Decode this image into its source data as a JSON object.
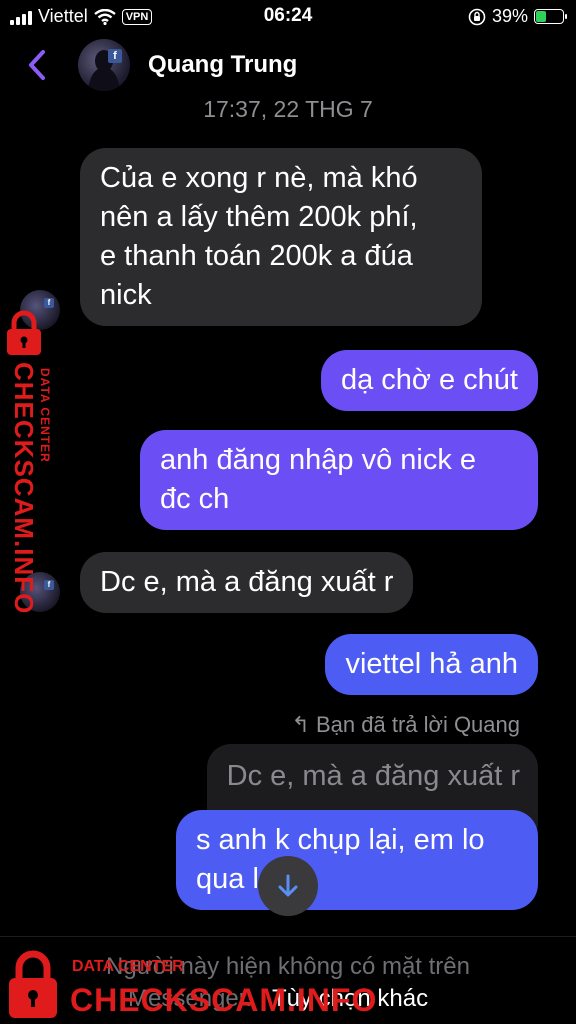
{
  "status_bar": {
    "carrier": "Viettel",
    "vpn": "VPN",
    "time": "06:24",
    "battery": "39%",
    "battery_level": 0.39
  },
  "header": {
    "contact_name": "Quang Trung"
  },
  "date_separator": "17:37, 22 THG 7",
  "messages": [
    {
      "from": "them",
      "lines": [
        "Của e xong r nè, mà khó",
        "nên a lấy thêm 200k phí,",
        "e thanh toán 200k a đúa",
        "nick"
      ]
    },
    {
      "from": "me",
      "lines": [
        "dạ chờ e chút"
      ]
    },
    {
      "from": "me",
      "lines": [
        "anh đăng nhập vô nick e",
        "đc ch"
      ]
    },
    {
      "from": "them",
      "lines": [
        "Dc e, mà a đăng xuất r"
      ]
    },
    {
      "from": "me",
      "lines": [
        "viettel hả anh"
      ]
    },
    {
      "from": "me",
      "lines": [
        "s anh k chụp lại, em lo",
        "qua l"
      ]
    }
  ],
  "reply": {
    "note": "Bạn đã trả lời Quang",
    "quoted": "Dc e, mà a đăng xuất r"
  },
  "footer": {
    "notice": "Người này hiện không có mặt trên",
    "notice_line2": "Messenger.",
    "more_options": "Tùy chọn khác"
  },
  "watermark": {
    "main": "CHECKSCAM.INFO",
    "sub": "DATA CENTER"
  },
  "colors": {
    "outgoing": "#6b4ff5",
    "outgoing_alt": "#4d5cf3",
    "incoming": "#2c2c2e",
    "accent": "#8b5cf6",
    "watermark": "#e01b1b"
  },
  "icons": [
    "back-chevron-icon",
    "wifi-icon",
    "lock-rotation-icon",
    "battery-icon",
    "scroll-down-arrow-icon",
    "padlock-icon"
  ]
}
